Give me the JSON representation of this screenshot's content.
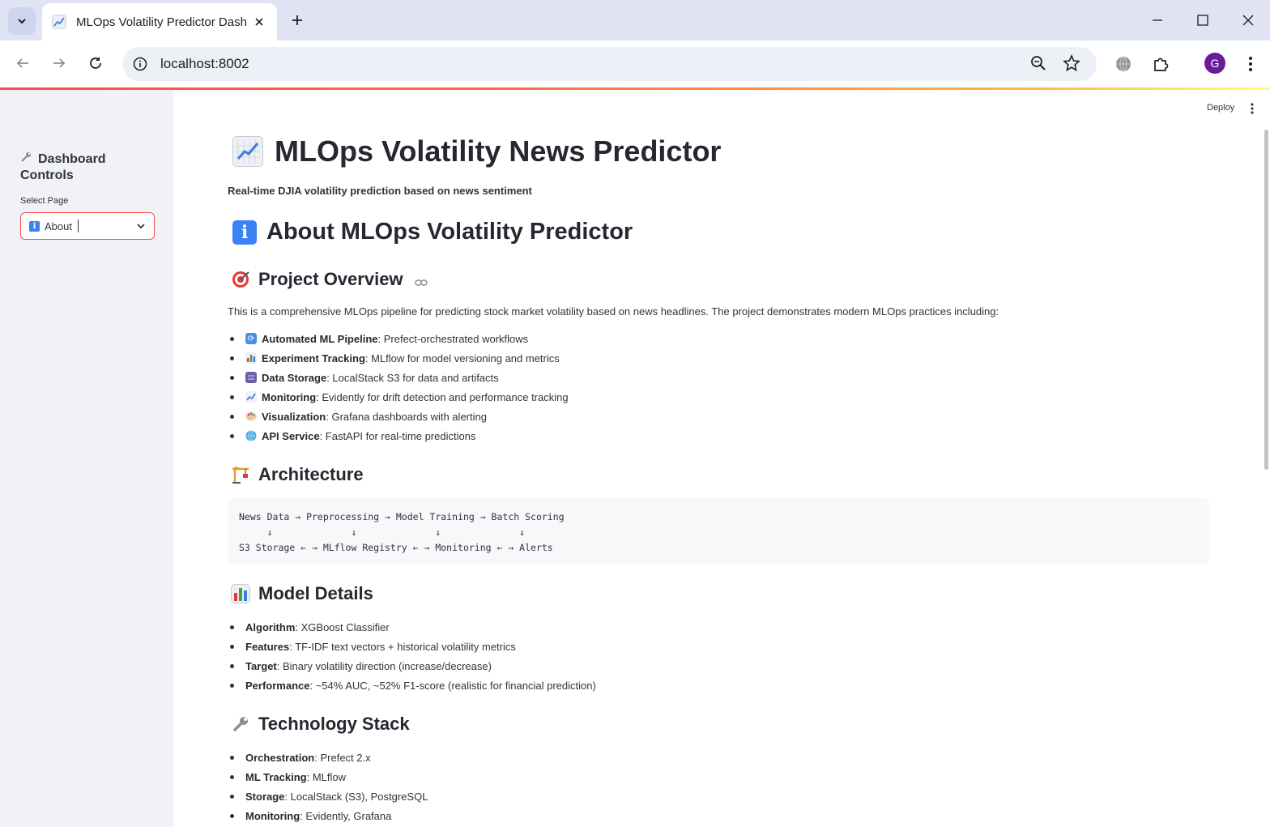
{
  "browser": {
    "tab_title": "MLOps Volatility Predictor Dash",
    "url": "localhost:8002",
    "avatar_letter": "G"
  },
  "sidebar": {
    "header": "Dashboard Controls",
    "select_label": "Select Page",
    "select_value": "About"
  },
  "header": {
    "deploy_label": "Deploy"
  },
  "main": {
    "title": "MLOps Volatility News Predictor",
    "subtitle": "Real-time DJIA volatility prediction based on news sentiment",
    "about_heading": "About MLOps Volatility Predictor",
    "overview_heading": "Project Overview",
    "overview_text": "This is a comprehensive MLOps pipeline for predicting stock market volatility based on news headlines. The project demonstrates modern MLOps practices including:",
    "practices": [
      {
        "label": "Automated ML Pipeline",
        "text": ": Prefect-orchestrated workflows",
        "icon": "arrows-cycle-icon"
      },
      {
        "label": "Experiment Tracking",
        "text": ": MLflow for model versioning and metrics",
        "icon": "bar-chart-icon"
      },
      {
        "label": "Data Storage",
        "text": ": LocalStack S3 for data and artifacts",
        "icon": "file-cabinet-icon"
      },
      {
        "label": "Monitoring",
        "text": ": Evidently for drift detection and performance tracking",
        "icon": "chart-up-icon"
      },
      {
        "label": "Visualization",
        "text": ": Grafana dashboards with alerting",
        "icon": "palette-icon"
      },
      {
        "label": "API Service",
        "text": ": FastAPI for real-time predictions",
        "icon": "globe-icon"
      }
    ],
    "architecture_heading": "Architecture",
    "architecture_code": [
      "News Data → Preprocessing → Model Training → Batch Scoring",
      "     ↓              ↓              ↓              ↓",
      "S3 Storage ← → MLflow Registry ← → Monitoring ← → Alerts"
    ],
    "model_heading": "Model Details",
    "model_details": [
      {
        "label": "Algorithm",
        "text": ": XGBoost Classifier"
      },
      {
        "label": "Features",
        "text": ": TF-IDF text vectors + historical volatility metrics"
      },
      {
        "label": "Target",
        "text": ": Binary volatility direction (increase/decrease)"
      },
      {
        "label": "Performance",
        "text": ": ~54% AUC, ~52% F1-score (realistic for financial prediction)"
      }
    ],
    "tech_heading": "Technology Stack",
    "tech_stack": [
      {
        "label": "Orchestration",
        "text": ": Prefect 2.x"
      },
      {
        "label": "ML Tracking",
        "text": ": MLflow"
      },
      {
        "label": "Storage",
        "text": ": LocalStack (S3), PostgreSQL"
      },
      {
        "label": "Monitoring",
        "text": ": Evidently, Grafana"
      }
    ]
  },
  "colors": {
    "accent": "#ff4b4b",
    "sidebar_bg": "#f0f2f6",
    "text": "#31333f"
  }
}
